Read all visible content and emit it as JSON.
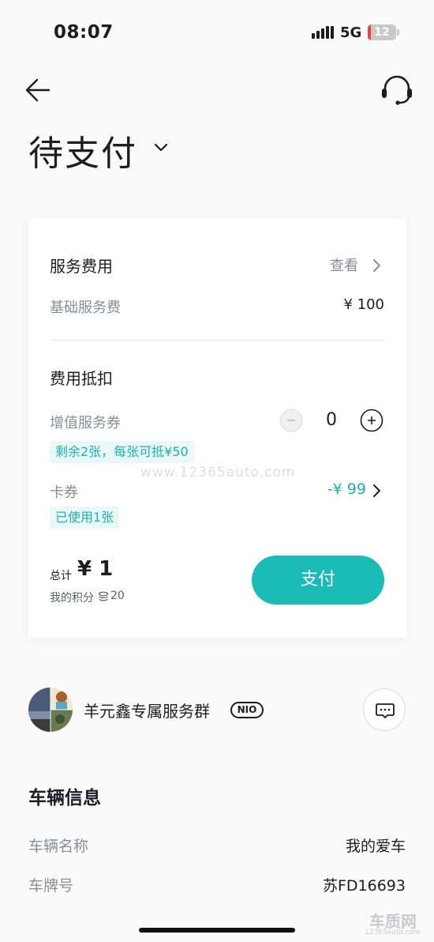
{
  "status_bar": {
    "time": "08:07",
    "network": "5G",
    "battery": "12",
    "battery_level": 0.12
  },
  "header": {
    "title": "待支付"
  },
  "service_fee": {
    "title": "服务费用",
    "view_label": "查看",
    "base_label": "基础服务费",
    "base_value": "¥ 100"
  },
  "deduction": {
    "title": "费用抵扣",
    "voucher_label": "增值服务券",
    "voucher_count": "0",
    "voucher_tag": "剩余2张，每张可抵¥50",
    "card_label": "卡券",
    "card_value": "-¥ 99",
    "card_tag": "已使用1张"
  },
  "total": {
    "label": "总计",
    "amount": "¥ 1",
    "points_label": "我的积分",
    "points_value": "20",
    "pay_label": "支付"
  },
  "service_group": {
    "name": "羊元鑫专属服务群",
    "badge": "NIO"
  },
  "vehicle": {
    "title": "车辆信息",
    "rows": [
      {
        "label": "车辆名称",
        "value": "我的爱车"
      },
      {
        "label": "车牌号",
        "value": "苏FD16693"
      }
    ]
  },
  "watermark": {
    "center": "www.12365auto.com",
    "brand": "车质网",
    "url": "12365auto.com"
  },
  "colors": {
    "accent": "#1cbcb6",
    "text": "#1c1c24",
    "muted": "#8a8d99"
  }
}
